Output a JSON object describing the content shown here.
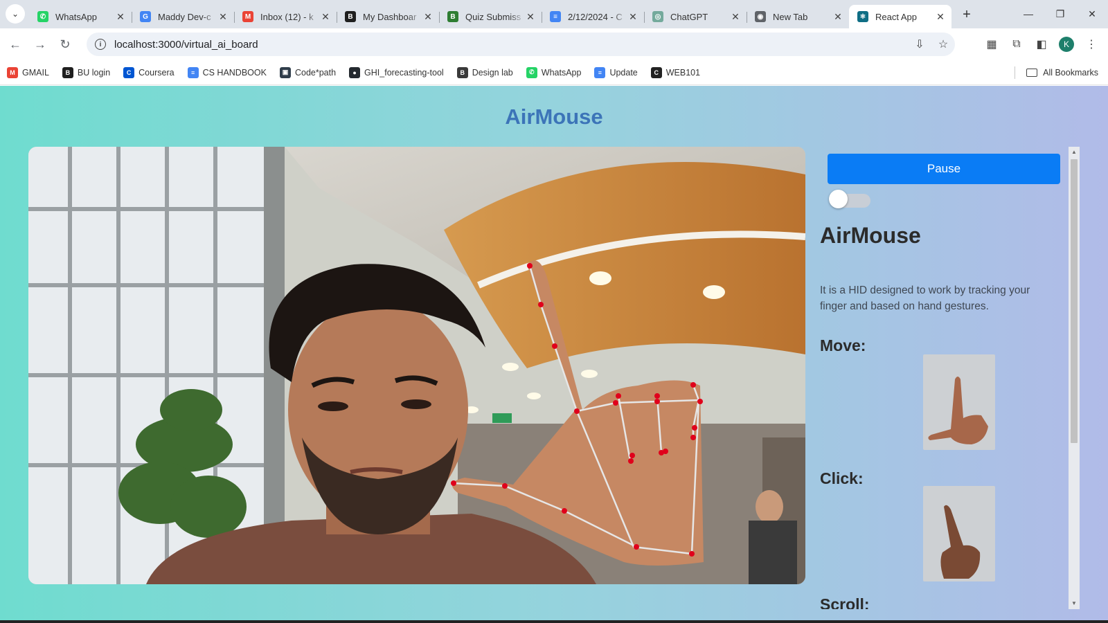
{
  "browser": {
    "tabs": [
      {
        "title": "WhatsApp",
        "icon": "whatsapp-icon",
        "color": "#25d366",
        "glyph": "✆"
      },
      {
        "title": "Maddy Dev-c",
        "icon": "google-icon",
        "color": "#4285f4",
        "glyph": "G"
      },
      {
        "title": "Inbox (12) - k",
        "icon": "gmail-icon",
        "color": "#ea4335",
        "glyph": "M"
      },
      {
        "title": "My Dashboar",
        "icon": "blackboard-icon",
        "color": "#1f1f1f",
        "glyph": "B"
      },
      {
        "title": "Quiz Submiss",
        "icon": "blackboard-green-icon",
        "color": "#2e7d32",
        "glyph": "B"
      },
      {
        "title": "2/12/2024 - C",
        "icon": "docs-icon",
        "color": "#4285f4",
        "glyph": "≡"
      },
      {
        "title": "ChatGPT",
        "icon": "chatgpt-icon",
        "color": "#74aa9c",
        "glyph": "◎"
      },
      {
        "title": "New Tab",
        "icon": "chrome-icon",
        "color": "#5f6368",
        "glyph": "◉"
      },
      {
        "title": "React App",
        "icon": "react-icon",
        "color": "#0f6e85",
        "glyph": "⚛"
      }
    ],
    "url": "localhost:3000/virtual_ai_board",
    "profile_initial": "K",
    "bookmarks": [
      {
        "label": "GMAIL",
        "icon": "gmail-icon",
        "color": "#ea4335",
        "glyph": "M"
      },
      {
        "label": "BU login",
        "icon": "blackboard-icon",
        "color": "#1f1f1f",
        "glyph": "B"
      },
      {
        "label": "Coursera",
        "icon": "coursera-icon",
        "color": "#0056d2",
        "glyph": "C"
      },
      {
        "label": "CS HANDBOOK",
        "icon": "docs-icon",
        "color": "#4285f4",
        "glyph": "≡"
      },
      {
        "label": "Code*path",
        "icon": "codepath-icon",
        "color": "#2f3d4a",
        "glyph": "▣"
      },
      {
        "label": "GHI_forecasting-tool",
        "icon": "github-icon",
        "color": "#24292f",
        "glyph": "●"
      },
      {
        "label": "Design lab",
        "icon": "blackboard-icon",
        "color": "#3a3a3a",
        "glyph": "B"
      },
      {
        "label": "WhatsApp",
        "icon": "whatsapp-icon",
        "color": "#25d366",
        "glyph": "✆"
      },
      {
        "label": "Update",
        "icon": "docs-icon",
        "color": "#4285f4",
        "glyph": "≡"
      },
      {
        "label": "WEB101",
        "icon": "codepath-c-icon",
        "color": "#222222",
        "glyph": "C"
      }
    ],
    "all_bookmarks": "All Bookmarks"
  },
  "app": {
    "title": "AirMouse",
    "pause_label": "Pause",
    "toggle_on": false,
    "heading": "AirMouse",
    "description": "It is a HID designed to work by tracking your finger and based on hand gestures.",
    "gestures": [
      {
        "label": "Move:",
        "icon": "hand-l-gesture-icon"
      },
      {
        "label": "Click:",
        "icon": "hand-point-gesture-icon"
      },
      {
        "label": "Scroll:"
      }
    ]
  },
  "colors": {
    "accent": "#0a7cf5",
    "title": "#3c74b8",
    "landmark": "#e0001b"
  }
}
